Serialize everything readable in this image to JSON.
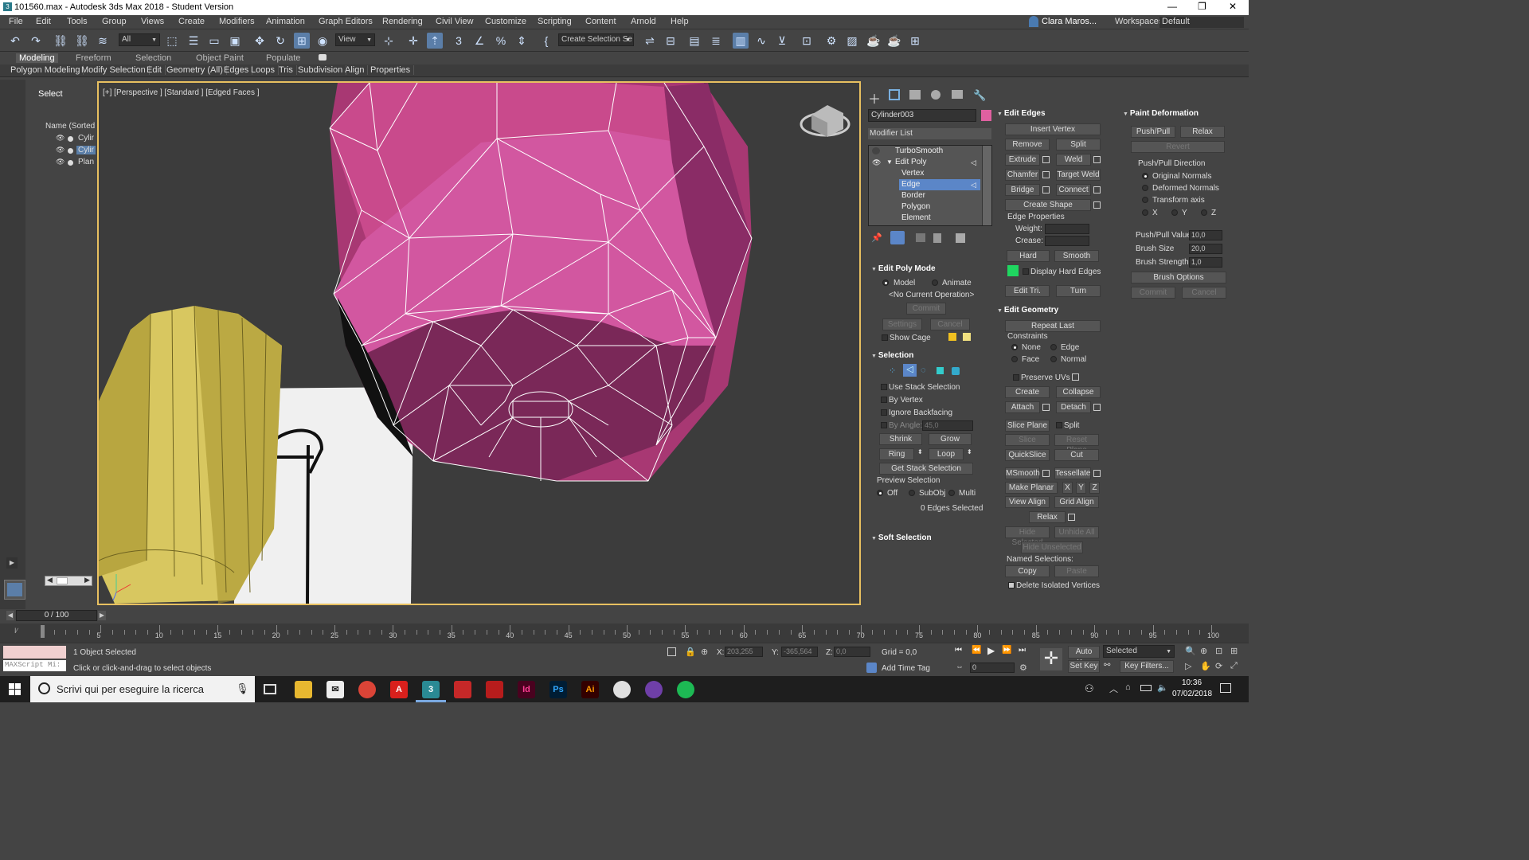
{
  "window": {
    "title": "101560.max - Autodesk 3ds Max 2018 - Student Version",
    "min": "—",
    "max": "❐",
    "close": "✕"
  },
  "menu": [
    "File",
    "Edit",
    "Tools",
    "Group",
    "Views",
    "Create",
    "Modifiers",
    "Animation",
    "Graph Editors",
    "Rendering",
    "Civil View",
    "Customize",
    "Scripting",
    "Content",
    "Arnold",
    "Help"
  ],
  "user": "Clara Maros...",
  "workspaces_label": "Workspaces:",
  "workspace": "Default",
  "toolbar": {
    "filter": "All",
    "view": "View",
    "selection_set": "Create Selection Se"
  },
  "ribbon_tabs": [
    "Modeling",
    "Freeform",
    "Selection",
    "Object Paint",
    "Populate"
  ],
  "ribbon_sub": [
    "Polygon Modeling",
    "Modify Selection",
    "Edit",
    "Geometry (All)",
    "Edges",
    "Loops",
    "Tris",
    "Subdivision",
    "Align",
    "Properties"
  ],
  "scene": {
    "select_label": "Select",
    "column": "Name (Sorted A",
    "items": [
      "Cylir",
      "Cylir",
      "Plan"
    ]
  },
  "viewport": {
    "label": "[+] [Perspective ] [Standard ] [Edged Faces ]"
  },
  "command": {
    "object_name": "Cylinder003",
    "object_color": "#e060a0",
    "modifier_list": "Modifier List",
    "stack": [
      "TurboSmooth",
      "Edit Poly",
      "Vertex",
      "Edge",
      "Border",
      "Polygon",
      "Element"
    ],
    "edit_poly_mode": {
      "title": "Edit Poly Mode",
      "model": "Model",
      "animate": "Animate",
      "status": "<No Current Operation>",
      "commit": "Commit",
      "settings": "Settings",
      "cancel": "Cancel",
      "show_cage": "Show Cage"
    },
    "selection": {
      "title": "Selection",
      "use_stack": "Use Stack Selection",
      "by_vertex": "By Vertex",
      "ignore_backfacing": "Ignore Backfacing",
      "by_angle": "By Angle:",
      "angle": "45,0",
      "shrink": "Shrink",
      "grow": "Grow",
      "ring": "Ring",
      "loop": "Loop",
      "get_stack": "Get Stack Selection",
      "preview": "Preview Selection",
      "off": "Off",
      "subobj": "SubObj",
      "multi": "Multi",
      "count": "0 Edges Selected"
    },
    "soft_selection": "Soft Selection",
    "edit_edges": {
      "title": "Edit Edges",
      "insert_vertex": "Insert Vertex",
      "remove": "Remove",
      "split": "Split",
      "extrude": "Extrude",
      "weld": "Weld",
      "chamfer": "Chamfer",
      "target_weld": "Target Weld",
      "bridge": "Bridge",
      "connect": "Connect",
      "create_shape": "Create Shape",
      "edge_properties": "Edge Properties",
      "weight": "Weight:",
      "crease": "Crease:",
      "hard": "Hard",
      "smooth": "Smooth",
      "display_hard": "Display Hard Edges",
      "edit_tri": "Edit Tri.",
      "turn": "Turn"
    },
    "edit_geometry": {
      "title": "Edit Geometry",
      "repeat_last": "Repeat Last",
      "constraints": "Constraints",
      "none": "None",
      "edge": "Edge",
      "face": "Face",
      "normal": "Normal",
      "preserve_uvs": "Preserve UVs",
      "create": "Create",
      "collapse": "Collapse",
      "attach": "Attach",
      "detach": "Detach",
      "slice_plane": "Slice Plane",
      "split": "Split",
      "slice": "Slice",
      "reset_plane": "Reset Plane",
      "quickslice": "QuickSlice",
      "cut": "Cut",
      "msmooth": "MSmooth",
      "tessellate": "Tessellate",
      "make_planar": "Make Planar",
      "x": "X",
      "y": "Y",
      "z": "Z",
      "view_align": "View Align",
      "grid_align": "Grid Align",
      "relax": "Relax",
      "hide_selected": "Hide Selected",
      "unhide_all": "Unhide All",
      "hide_unselected": "Hide Unselected",
      "named_selections": "Named Selections:",
      "copy": "Copy",
      "paste": "Paste",
      "delete_isolated": "Delete Isolated Vertices"
    },
    "paint_deformation": {
      "title": "Paint Deformation",
      "push_pull": "Push/Pull",
      "relax": "Relax",
      "revert": "Revert",
      "direction": "Push/Pull Direction",
      "original_normals": "Original Normals",
      "deformed_normals": "Deformed Normals",
      "transform_axis": "Transform axis",
      "x": "X",
      "y": "Y",
      "z": "Z",
      "value_label": "Push/Pull Value",
      "value": "10,0",
      "brush_size_label": "Brush Size",
      "brush_size": "20,0",
      "brush_strength_label": "Brush Strength",
      "brush_strength": "1,0",
      "brush_options": "Brush Options",
      "commit": "Commit",
      "cancel": "Cancel"
    }
  },
  "timeline": {
    "counter": "0 / 100",
    "ticks": [
      "5",
      "10",
      "15",
      "20",
      "25",
      "30",
      "35",
      "40",
      "45",
      "50",
      "55",
      "60",
      "65",
      "70",
      "75",
      "80",
      "85",
      "90",
      "95",
      "100"
    ]
  },
  "status": {
    "maxscript": "MAXScript Mi:",
    "selected": "1 Object Selected",
    "hint": "Click or click-and-drag to select objects",
    "x_label": "X:",
    "x": "203,255",
    "y_label": "Y:",
    "y": "-365,564",
    "z_label": "Z:",
    "z": "0,0",
    "grid": "Grid = 0,0",
    "add_time_tag": "Add Time Tag",
    "auto_key": "Auto Key",
    "set_key": "Set Key",
    "selected_dd": "Selected",
    "key_filters": "Key Filters...",
    "frame": "0"
  },
  "taskbar": {
    "search": "Scrivi qui per eseguire la ricerca",
    "time": "10:36",
    "date": "07/02/2018"
  }
}
